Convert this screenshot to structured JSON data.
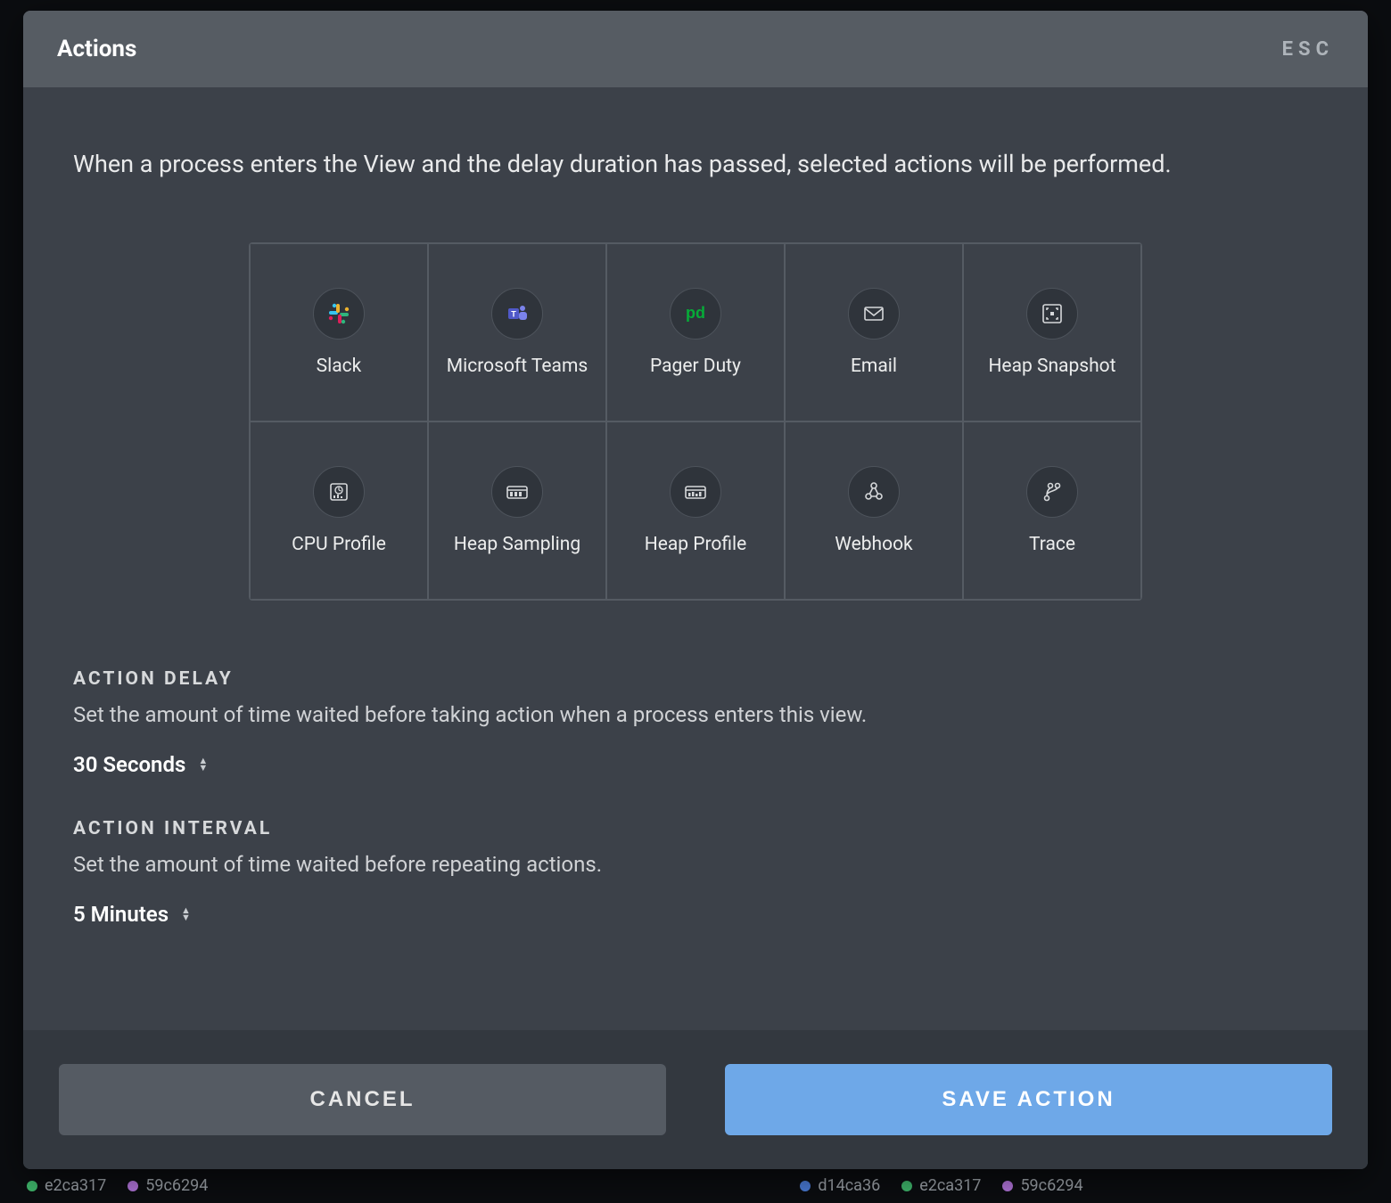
{
  "header": {
    "title": "Actions",
    "esc": "ESC"
  },
  "intro": "When a process enters the View and the delay duration has passed, selected actions will be performed.",
  "actions": [
    {
      "id": "slack",
      "label": "Slack"
    },
    {
      "id": "msteams",
      "label": "Microsoft Teams"
    },
    {
      "id": "pagerduty",
      "label": "Pager Duty"
    },
    {
      "id": "email",
      "label": "Email"
    },
    {
      "id": "heapsnapshot",
      "label": "Heap Snapshot"
    },
    {
      "id": "cpuprofile",
      "label": "CPU Profile"
    },
    {
      "id": "heapsampling",
      "label": "Heap Sampling"
    },
    {
      "id": "heapprofile",
      "label": "Heap Profile"
    },
    {
      "id": "webhook",
      "label": "Webhook"
    },
    {
      "id": "trace",
      "label": "Trace"
    }
  ],
  "delay": {
    "label": "ACTION DELAY",
    "help": "Set the amount of time waited before taking action when a process enters this view.",
    "value": "30 Seconds"
  },
  "interval": {
    "label": "ACTION INTERVAL",
    "help": "Set the amount of time waited before repeating actions.",
    "value": "5 Minutes"
  },
  "footer": {
    "cancel": "CANCEL",
    "save": "SAVE ACTION"
  },
  "bg": {
    "a": "e2ca317",
    "b": "59c6294",
    "c": "d14ca36",
    "d": "e2ca317",
    "e": "59c6294"
  }
}
